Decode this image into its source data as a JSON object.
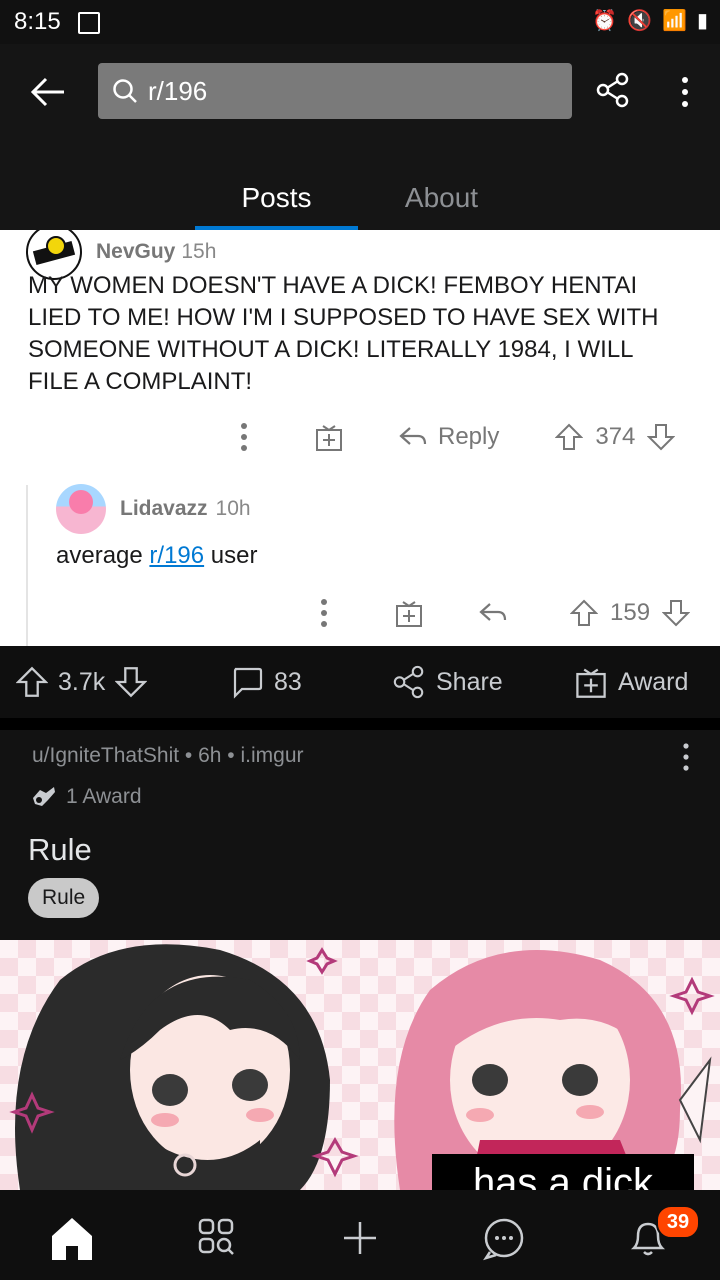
{
  "status_bar": {
    "time": "8:15"
  },
  "search": {
    "value": "r/196"
  },
  "tabs": [
    {
      "label": "Posts"
    },
    {
      "label": "About"
    }
  ],
  "comment1": {
    "author": "NevGuy",
    "time": "15h",
    "body": "MY WOMEN DOESN'T HAVE A DICK! FEMBOY HENTAI LIED TO ME! HOW I'M I SUPPOSED TO HAVE SEX WITH SOMEONE WITHOUT A DICK! LITERALLY 1984, I WILL FILE A COMPLAINT!",
    "reply_label": "Reply",
    "votes": "374"
  },
  "comment2": {
    "author": "Lidavazz",
    "time": "10h",
    "body_prefix": "average ",
    "body_link": "r/196",
    "body_suffix": " user",
    "votes": "159"
  },
  "post_actions": {
    "votes": "3.7k",
    "comments": "83",
    "share_label": "Share",
    "award_label": "Award"
  },
  "post": {
    "meta": "u/IgniteThatShit • 6h • i.imgur",
    "awards": "1 Award",
    "title": "Rule",
    "flair": "Rule",
    "image_text": "has a dick"
  },
  "notifications": {
    "count": "39"
  },
  "colors": {
    "accent": "#0079d3",
    "badge": "#ff4500"
  }
}
